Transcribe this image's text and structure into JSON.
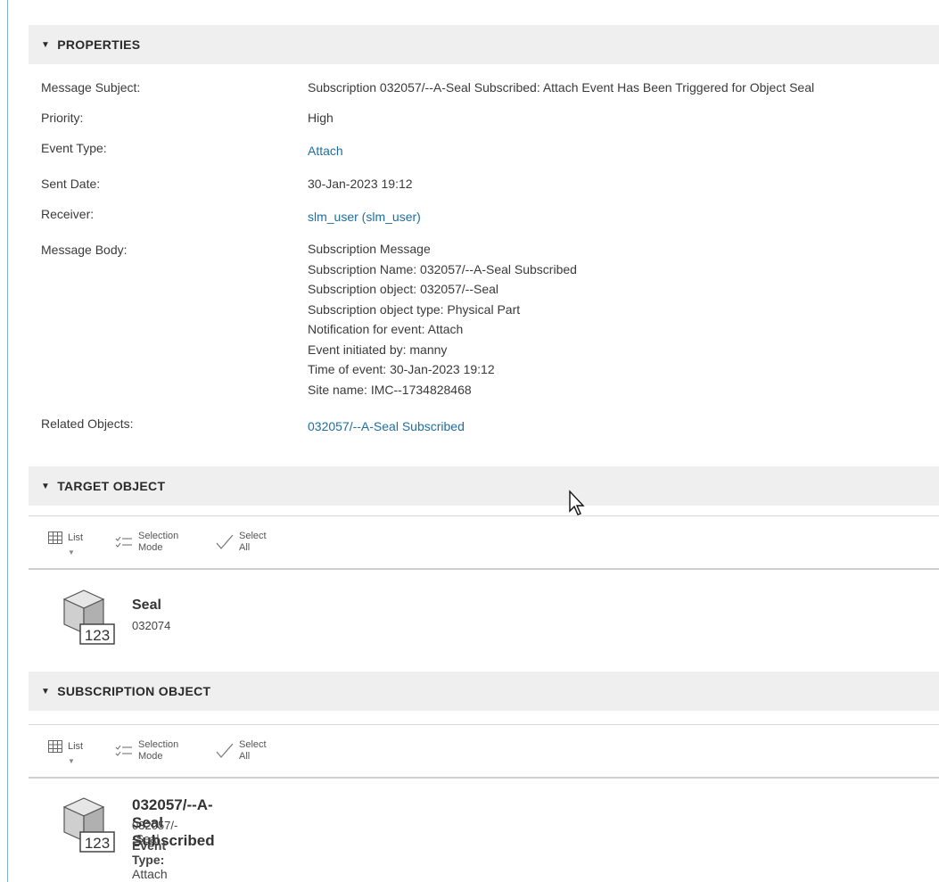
{
  "properties": {
    "header": "PROPERTIES",
    "rows": [
      {
        "label": "Message Subject:",
        "value": "Subscription 032057/--A-Seal Subscribed: Attach Event Has Been Triggered for Object Seal"
      },
      {
        "label": "Priority:",
        "value": "High"
      },
      {
        "label": "Event Type:",
        "value": "Attach"
      },
      {
        "label": "Sent Date:",
        "value": "30-Jan-2023 19:12"
      },
      {
        "label": "Receiver:",
        "value": "slm_user (slm_user)"
      },
      {
        "label": "Message Body:",
        "lines": [
          "Subscription Message",
          "Subscription Name: 032057/--A-Seal Subscribed",
          "Subscription object: 032057/--Seal",
          "Subscription object type: Physical Part",
          "Notification for event: Attach",
          "Event initiated by: manny",
          "Time of event: 30-Jan-2023 19:12",
          "Site name: IMC--1734828468"
        ]
      },
      {
        "label": "Related Objects:",
        "value": "032057/--A-Seal Subscribed"
      }
    ]
  },
  "target_object": {
    "header": "TARGET OBJECT",
    "toolbar": {
      "list": "List",
      "selection_1": "Selection",
      "selection_2": "Mode",
      "select_1": "Select",
      "select_2": "All"
    },
    "item": {
      "title": "Seal",
      "subtitle": "032074",
      "icon_badge": "123"
    }
  },
  "subscription_object": {
    "header": "SUBSCRIPTION OBJECT",
    "toolbar": {
      "list": "List",
      "selection_1": "Selection",
      "selection_2": "Mode",
      "select_1": "Select",
      "select_2": "All"
    },
    "item": {
      "title": "032057/--A-Seal Subscribed",
      "subtitle": "032057/--Seal",
      "event_label": "Event Type:",
      "event_value": "Attach",
      "icon_badge": "123"
    }
  },
  "colors": {
    "link": "#1f6e9c",
    "header_bg": "#efefef",
    "left_rule": "#7fb0d8"
  },
  "icons": [
    "triangle-down-icon",
    "grid-list-icon",
    "selection-mode-icon",
    "checkmark-icon",
    "part-cube-icon",
    "mouse-cursor-icon"
  ]
}
